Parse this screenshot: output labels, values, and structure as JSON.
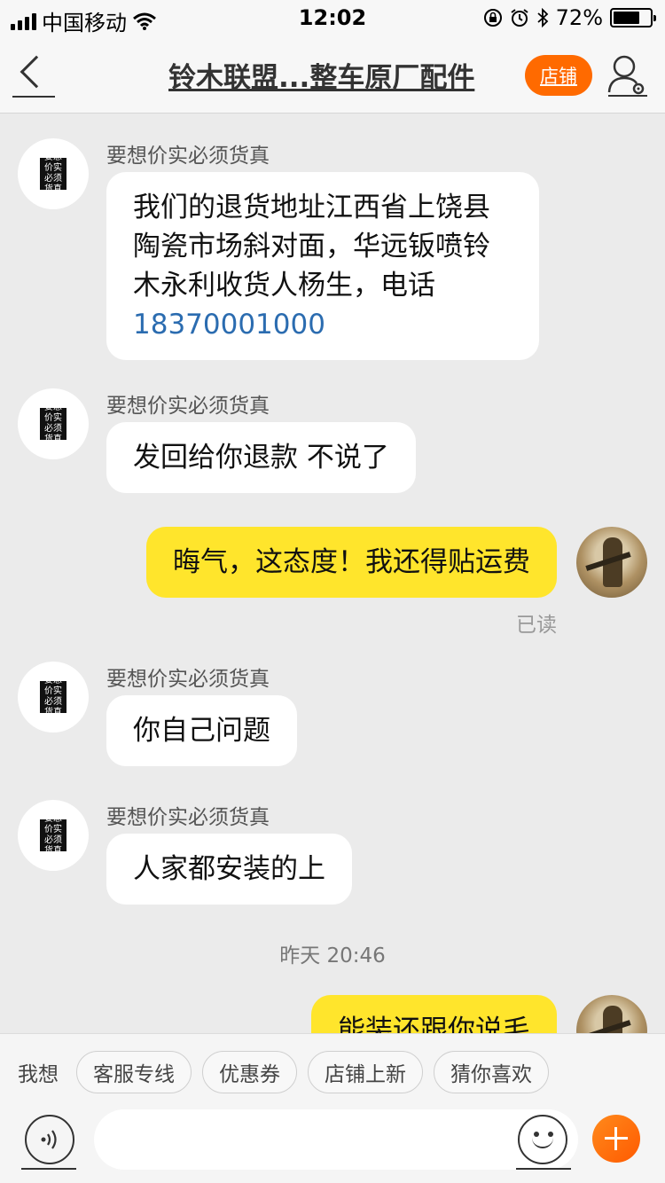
{
  "status_bar": {
    "carrier": "中国移动",
    "time": "12:02",
    "battery": "72%",
    "battery_level": 0.72
  },
  "nav": {
    "title": "铃木联盟...整车原厂配件",
    "shop_label": "店铺"
  },
  "shop": {
    "logo_text": "要想价实必须货真"
  },
  "messages": [
    {
      "sender": "要想价实必须货真",
      "text": "我们的退货地址江西省上饶县陶瓷市场斜对面，华远钣喷铃木永利收货人杨生，电话",
      "phone": "18370001000"
    },
    {
      "sender": "要想价实必须货真",
      "text": "发回给你退款 不说了"
    },
    {
      "text": "晦气，这态度！我还得贴运费",
      "status": "已读"
    },
    {
      "sender": "要想价实必须货真",
      "text": "你自己问题"
    },
    {
      "sender": "要想价实必须货真",
      "text": "人家都安装的上"
    },
    {
      "timestamp": "昨天 20:46"
    },
    {
      "text": "能装还跟你说毛"
    }
  ],
  "quick_bar": {
    "label": "我想",
    "chips": [
      "客服专线",
      "优惠券",
      "店铺上新",
      "猜你喜欢"
    ]
  },
  "input": {
    "placeholder": ""
  },
  "colors": {
    "outgoing_bubble": "#ffe52c",
    "accent": "#ff6a00",
    "phone_link": "#2b6cb0"
  }
}
